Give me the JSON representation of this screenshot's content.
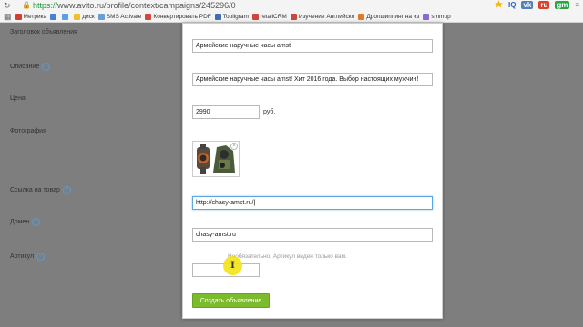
{
  "browser": {
    "url_https": "https://",
    "url_rest": "www.avito.ru/profile/context/campaigns/245296/0",
    "bookmarks": [
      {
        "label": "Метрика",
        "color": "#d33f2f"
      },
      {
        "label": "",
        "color": "#4b7fd4"
      },
      {
        "label": "",
        "color": "#5aa0e0"
      },
      {
        "label": "диск",
        "color": "#f0c02a"
      },
      {
        "label": "SMS Activate",
        "color": "#6b9ed4"
      },
      {
        "label": "Конвертировать PDF",
        "color": "#d5463a"
      },
      {
        "label": "Tooligram",
        "color": "#3e6fb5"
      },
      {
        "label": "retailCRM",
        "color": "#d0443c"
      },
      {
        "label": "Изучение Английско",
        "color": "#c94a3a"
      },
      {
        "label": "Дропшиппинг на из",
        "color": "#e07a2a"
      },
      {
        "label": "smmup",
        "color": "#8a6ad0"
      }
    ],
    "right_icons": [
      "★",
      "IQ",
      "vk",
      "ru",
      "gm",
      "≡"
    ]
  },
  "form": {
    "title_label": "Заголовок объявления",
    "title_value": "Армейские наручные часы amst",
    "description_label": "Описание",
    "description_value": "Армейские наручные часы amst! Хит 2016 года. Выбор настоящих мужчин!",
    "price_label": "Цена",
    "price_value": "2990",
    "price_unit": "руб.",
    "photo_label": "Фотография",
    "link_label": "Ссылка на товар",
    "link_value": "http://chasy-amst.ru/",
    "domain_label": "Домен",
    "domain_value": "chasy-amst.ru",
    "article_label": "Артикул",
    "article_hint": "Необязательно. Артикул виден только вам.",
    "article_value": "",
    "submit_label": "Создать объявление"
  }
}
